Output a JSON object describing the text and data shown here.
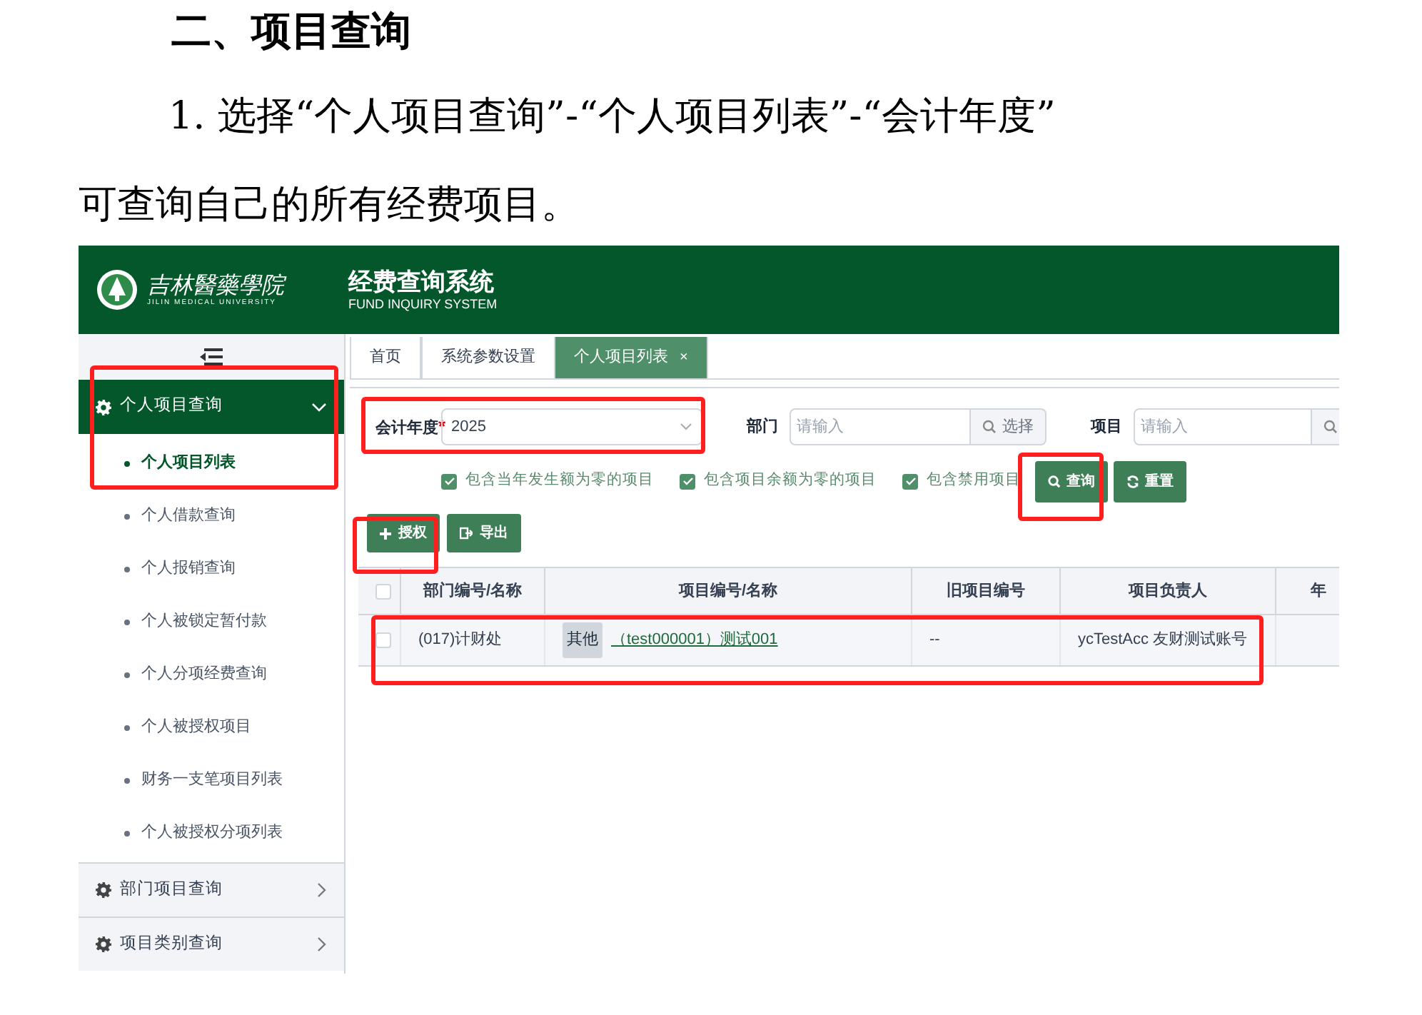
{
  "document": {
    "heading": "二、项目查询",
    "paragraph_line_1": "1. 选择“个人项目查询”-“个人项目列表”-“会计年度”",
    "paragraph_line_2": "可查询自己的所有经费项目。"
  },
  "header": {
    "school_name": "吉林醫藥學院",
    "school_name_en": "JILIN MEDICAL UNIVERSITY",
    "system_title": "经费查询系统",
    "system_title_en": "FUND INQUIRY SYSTEM"
  },
  "sidebar": {
    "groups": [
      {
        "label": "个人项目查询",
        "expanded": true,
        "children": [
          {
            "label": "个人项目列表",
            "selected": true
          },
          {
            "label": "个人借款查询",
            "selected": false
          },
          {
            "label": "个人报销查询",
            "selected": false
          },
          {
            "label": "个人被锁定暂付款",
            "selected": false
          },
          {
            "label": "个人分项经费查询",
            "selected": false
          },
          {
            "label": "个人被授权项目",
            "selected": false
          },
          {
            "label": "财务一支笔项目列表",
            "selected": false
          },
          {
            "label": "个人被授权分项列表",
            "selected": false
          }
        ]
      },
      {
        "label": "部门项目查询",
        "expanded": false
      },
      {
        "label": "项目类别查询",
        "expanded": false
      }
    ]
  },
  "tabs": [
    {
      "label": "首页",
      "selected": false
    },
    {
      "label": "系统参数设置",
      "selected": false
    },
    {
      "label": "个人项目列表",
      "selected": true,
      "close": "×"
    }
  ],
  "filters": {
    "year": {
      "label": "会计年度",
      "required_mark": "*",
      "value": "2025"
    },
    "department": {
      "label": "部门",
      "placeholder": "请输入",
      "button": "选择"
    },
    "project": {
      "label": "项目",
      "placeholder": "请输入"
    }
  },
  "checkboxes": [
    {
      "label": "包含当年发生额为零的项目",
      "checked": true
    },
    {
      "label": "包含项目余额为零的项目",
      "checked": true
    },
    {
      "label": "包含禁用项目",
      "checked": true
    }
  ],
  "search_buttons": [
    "查询",
    "重置"
  ],
  "toolbar_buttons": [
    "授权",
    "导出"
  ],
  "table": {
    "all_checked": false,
    "columns": [
      "部门编号/名称",
      "项目编号/名称",
      "旧项目编号",
      "项目负责人",
      "年"
    ],
    "rows": [
      {
        "checked": false,
        "department": "(017)计财处",
        "tag": "其他",
        "project": "（test000001）测试001",
        "old_code": "--",
        "owner": "ycTestAcc 友财测试账号"
      }
    ]
  }
}
